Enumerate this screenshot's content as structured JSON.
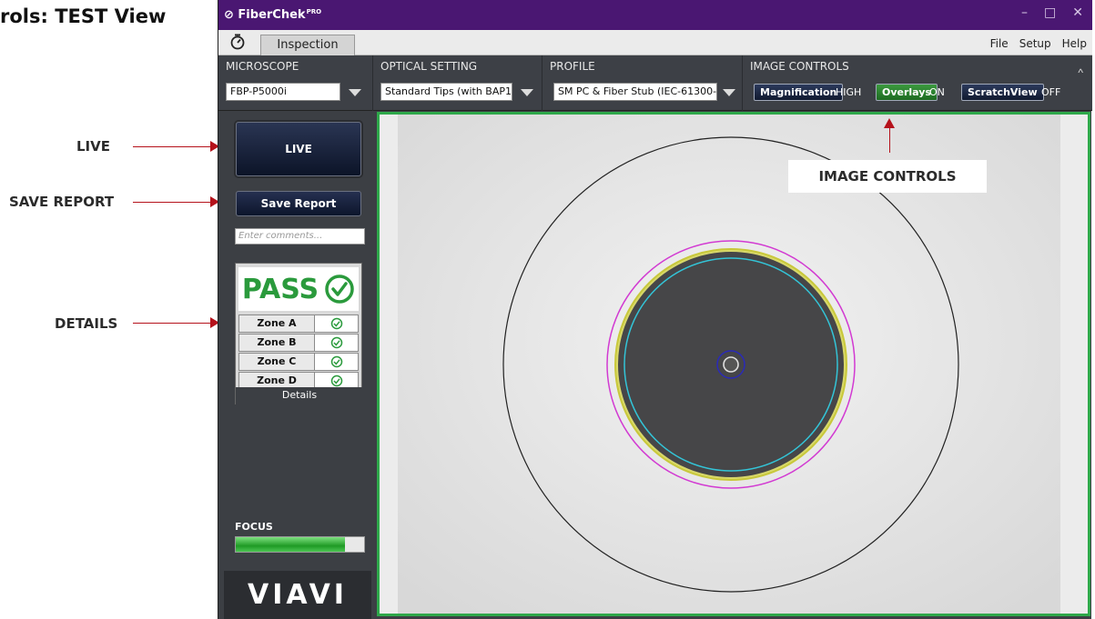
{
  "doc_title": "rols: TEST View",
  "callouts": {
    "live": "LIVE",
    "save_report": "SAVE REPORT",
    "details": "DETAILS",
    "image_controls": "IMAGE CONTROLS"
  },
  "app": {
    "brand": "FiberChek",
    "brand_sup": "PRO",
    "window_controls": {
      "minimize": "–",
      "maximize": "□",
      "close": "✕"
    },
    "tab": "Inspection",
    "menu": [
      "File",
      "Setup",
      "Help"
    ]
  },
  "toolbar": {
    "microscope": {
      "label": "MICROSCOPE",
      "value": "FBP-P5000i"
    },
    "optical": {
      "label": "OPTICAL SETTING",
      "value": "Standard Tips (with BAP1)"
    },
    "profile": {
      "label": "PROFILE",
      "value": "SM PC & Fiber Stub (IEC-61300-3"
    },
    "image_controls": {
      "label": "IMAGE CONTROLS",
      "magnification": {
        "label": "Magnification",
        "state": "HIGH"
      },
      "overlays": {
        "label": "Overlays",
        "state": "ON"
      },
      "scratchview": {
        "label": "ScratchView",
        "state": "OFF"
      }
    },
    "collapse_icon": "^"
  },
  "left_panel": {
    "live_label": "LIVE",
    "save_label": "Save Report",
    "comments_placeholder": "Enter comments...",
    "result": "PASS",
    "zones": [
      {
        "name": "Zone A",
        "status": "pass"
      },
      {
        "name": "Zone B",
        "status": "pass"
      },
      {
        "name": "Zone C",
        "status": "pass"
      },
      {
        "name": "Zone D",
        "status": "pass"
      }
    ],
    "details_label": "Details",
    "focus_label": "FOCUS",
    "focus_level": 0.85,
    "logo": "VIAVI"
  },
  "colors": {
    "titlebar": "#4a1772",
    "pass_green": "#2a9a3c",
    "frame_green": "#2ea84a",
    "callout_arrow": "#b5121b"
  }
}
